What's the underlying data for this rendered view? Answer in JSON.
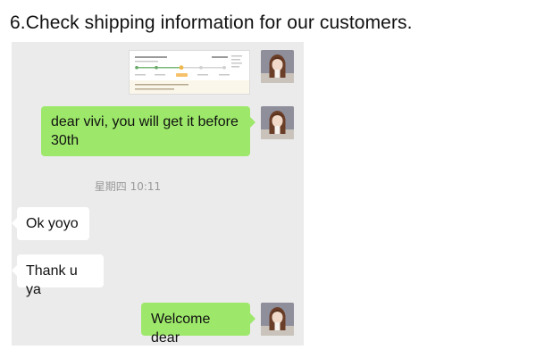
{
  "heading": "6.Check shipping information for our customers.",
  "chat": {
    "messages": [
      {
        "sender": "me",
        "type": "image"
      },
      {
        "sender": "me",
        "type": "text",
        "text": "dear vivi, you will get it before 30th"
      },
      {
        "sender": "other",
        "type": "text",
        "text": "Ok yoyo"
      },
      {
        "sender": "other",
        "type": "text",
        "text": "Thank u ya"
      },
      {
        "sender": "me",
        "type": "text",
        "text": "Welcome dear"
      }
    ],
    "timestamp": "星期四 10:11"
  },
  "colors": {
    "chat_background": "#ebebeb",
    "outgoing_bubble": "#9de86a",
    "incoming_bubble": "#ffffff",
    "timestamp_text": "#9a9a9a"
  },
  "icons": {
    "avatar": "user-avatar-girl-icon"
  }
}
